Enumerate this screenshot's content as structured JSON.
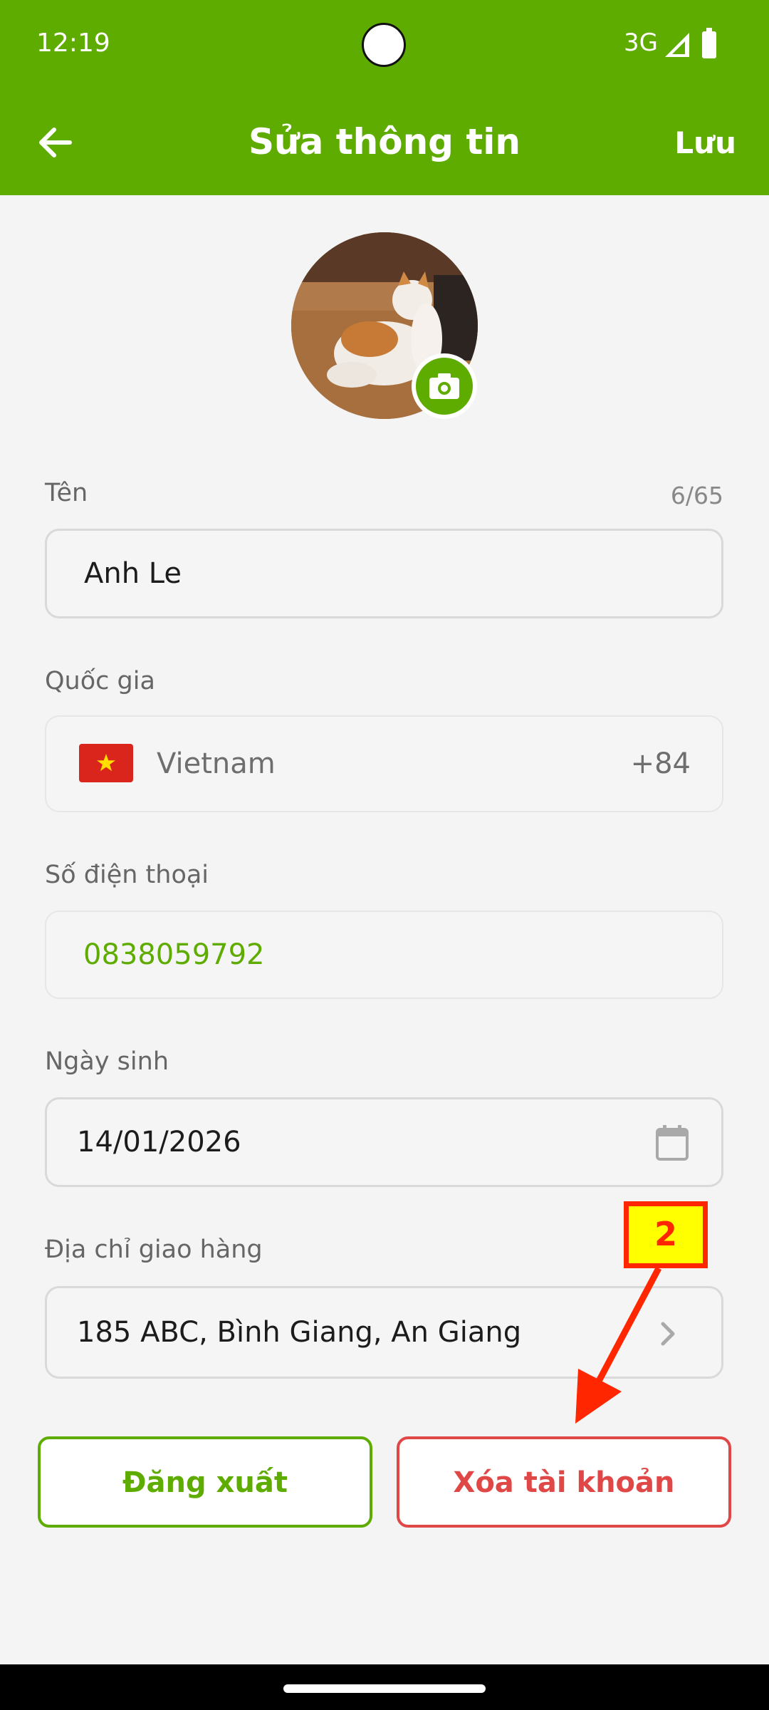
{
  "status_bar": {
    "time": "12:19",
    "network": "3G"
  },
  "header": {
    "title": "Sửa thông tin",
    "save_label": "Lưu"
  },
  "form": {
    "name": {
      "label": "Tên",
      "counter": "6/65",
      "value": "Anh Le"
    },
    "country": {
      "label": "Quốc gia",
      "value": "Vietnam",
      "dial_code": "+84"
    },
    "phone": {
      "label": "Số điện thoại",
      "value": "0838059792"
    },
    "birthday": {
      "label": "Ngày sinh",
      "value": "14/01/2026"
    },
    "address": {
      "label": "Địa chỉ giao hàng",
      "value": "185 ABC, Bình Giang, An Giang"
    }
  },
  "buttons": {
    "logout": "Đăng xuất",
    "delete_account": "Xóa tài khoản"
  },
  "annotation": {
    "step": "2"
  },
  "colors": {
    "primary": "#5fac00",
    "danger": "#e04848",
    "annotation": "#ff2600"
  }
}
